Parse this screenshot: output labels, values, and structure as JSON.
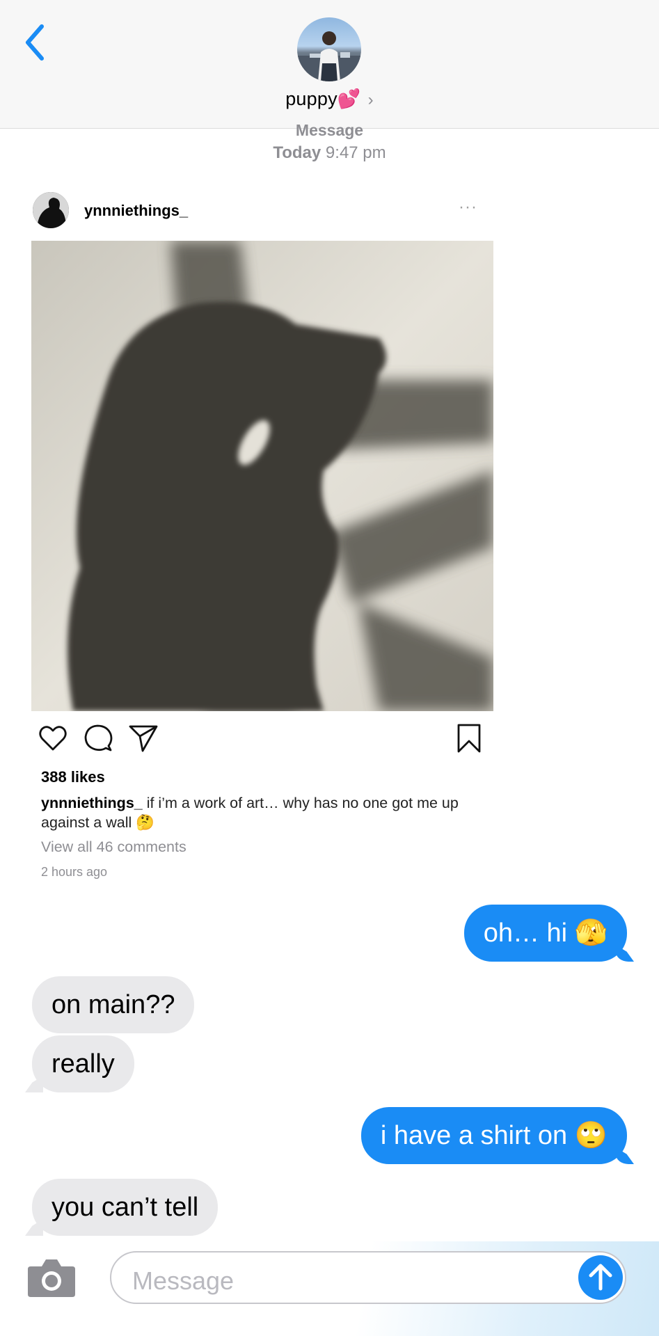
{
  "header": {
    "contact_name": "puppy💕",
    "chevron": "›",
    "back_icon": "chevron-left-icon"
  },
  "timestamp": {
    "label": "Message",
    "day": "Today",
    "time": "9:47 pm"
  },
  "post": {
    "username": "ynnniethings_",
    "more": "···",
    "likes": "388 likes",
    "caption_user": "ynnniethings_",
    "caption_text": " if i’m a work of art… why has no one got me up against a wall 🤔",
    "comments_link": "View all 46 comments",
    "time_ago": "2 hours ago",
    "icons": [
      "heart-icon",
      "comment-icon",
      "share-icon",
      "bookmark-icon"
    ]
  },
  "messages": [
    {
      "from": "me",
      "text": "oh… hi 🫣"
    },
    {
      "from": "them",
      "text": "on main??"
    },
    {
      "from": "them",
      "text": "really"
    },
    {
      "from": "me",
      "text": "i have a shirt on 🙄"
    },
    {
      "from": "them",
      "text": "you can’t tell"
    }
  ],
  "composer": {
    "placeholder": "Message"
  },
  "colors": {
    "accent": "#1a8cf5",
    "received_bubble": "#e9e9eb",
    "secondary_text": "#8e8e93"
  }
}
